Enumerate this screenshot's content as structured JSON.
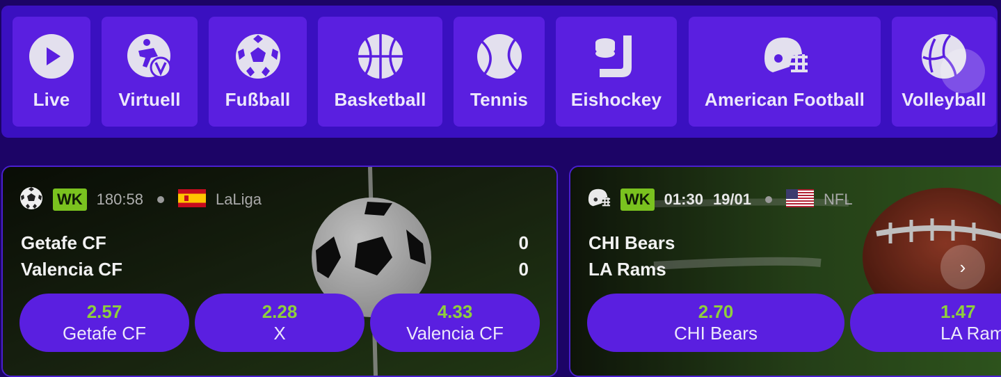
{
  "sports_nav": {
    "items": [
      {
        "label": "Live",
        "icon": "play-icon"
      },
      {
        "label": "Virtuell",
        "icon": "virtual-sports-icon"
      },
      {
        "label": "Fußball",
        "icon": "soccer-ball-icon"
      },
      {
        "label": "Basketball",
        "icon": "basketball-icon"
      },
      {
        "label": "Tennis",
        "icon": "tennis-ball-icon"
      },
      {
        "label": "Eishockey",
        "icon": "hockey-icon"
      },
      {
        "label": "American Football",
        "icon": "football-helmet-icon"
      },
      {
        "label": "Volleyball",
        "icon": "volleyball-icon"
      }
    ]
  },
  "matches": [
    {
      "sport_icon": "soccer-ball-icon",
      "badge": "WK",
      "time": "180:58",
      "flag": "spain-flag-icon",
      "league": "LaLiga",
      "team_home": "Getafe CF",
      "team_away": "Valencia CF",
      "score_home": "0",
      "score_away": "0",
      "odds": [
        {
          "value": "2.57",
          "label": "Getafe CF"
        },
        {
          "value": "2.28",
          "label": "X"
        },
        {
          "value": "4.33",
          "label": "Valencia CF"
        }
      ]
    },
    {
      "sport_icon": "football-helmet-icon",
      "badge": "WK",
      "time": "01:30",
      "date": "19/01",
      "flag": "usa-flag-icon",
      "league": "NFL",
      "team_home": "CHI Bears",
      "team_away": "LA Rams",
      "odds": [
        {
          "value": "2.70",
          "label": "CHI Bears"
        },
        {
          "value": "1.47",
          "label": "LA Rams"
        }
      ]
    }
  ],
  "colors": {
    "page_bg": "#1c0466",
    "nav_bg": "#3a10c0",
    "tile_bg": "#5a1fe0",
    "odd_value": "#8fcf3c",
    "badge_bg": "#7ac21f"
  }
}
